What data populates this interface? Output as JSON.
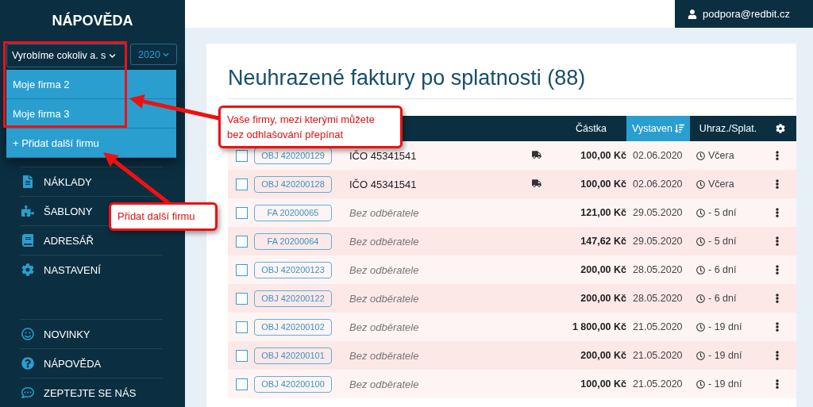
{
  "sidebar": {
    "title": "NÁPOVĚDA",
    "company_select": {
      "value": "Vyrobíme cokoliv a. s"
    },
    "year_select": {
      "value": "2020"
    },
    "company_menu": {
      "expanded": true,
      "items": [
        {
          "label": "Moje firma 2"
        },
        {
          "label": "Moje firma 3"
        }
      ],
      "add_label": "+ Přidat další firmu"
    },
    "nav": [
      {
        "label": "NÁKLADY"
      },
      {
        "label": "ŠABLONY"
      },
      {
        "label": "ADRESÁŘ"
      },
      {
        "label": "NASTAVENÍ"
      }
    ],
    "bottom_nav": [
      {
        "label": "NOVINKY"
      },
      {
        "label": "NÁPOVĚDA"
      },
      {
        "label": "ZEPTEJTE SE NÁS"
      }
    ]
  },
  "top_bar": {
    "user": "podpora@redbit.cz"
  },
  "page_title": "Neuhrazené faktury po splatnosti (88)",
  "table": {
    "columns": [
      {
        "label": "Částka",
        "selected": false
      },
      {
        "label": "Vystaven",
        "selected": true
      },
      {
        "label": "Uhraz./Splat.",
        "selected": false
      }
    ],
    "rows": [
      {
        "checked": false,
        "number": "OBJ 420200129",
        "customer": "IČO 45341541",
        "no_customer": false,
        "delivery": true,
        "amount": "100,00 Kč",
        "issued": "02.06.2020",
        "due": "Včera"
      },
      {
        "checked": false,
        "number": "OBJ 420200128",
        "customer": "IČO 45341541",
        "no_customer": false,
        "delivery": true,
        "amount": "100,00 Kč",
        "issued": "02.06.2020",
        "due": "Včera"
      },
      {
        "checked": false,
        "number": "FA 20200065",
        "customer": "Bez odběratele",
        "no_customer": true,
        "delivery": false,
        "amount": "121,00 Kč",
        "issued": "29.05.2020",
        "due": "- 5 dní"
      },
      {
        "checked": false,
        "number": "FA 20200064",
        "customer": "Bez odběratele",
        "no_customer": true,
        "delivery": false,
        "amount": "147,62 Kč",
        "issued": "29.05.2020",
        "due": "- 5 dní"
      },
      {
        "checked": false,
        "number": "OBJ 420200123",
        "customer": "Bez odběratele",
        "no_customer": true,
        "delivery": false,
        "amount": "200,00 Kč",
        "issued": "28.05.2020",
        "due": "- 6 dní"
      },
      {
        "checked": false,
        "number": "OBJ 420200122",
        "customer": "Bez odběratele",
        "no_customer": true,
        "delivery": false,
        "amount": "200,00 Kč",
        "issued": "28.05.2020",
        "due": "- 6 dní"
      },
      {
        "checked": false,
        "number": "OBJ 420200102",
        "customer": "Bez odběratele",
        "no_customer": true,
        "delivery": false,
        "amount": "1 800,00 Kč",
        "issued": "21.05.2020",
        "due": "- 19 dní"
      },
      {
        "checked": false,
        "number": "OBJ 420200101",
        "customer": "Bez odběratele",
        "no_customer": true,
        "delivery": false,
        "amount": "200,00 Kč",
        "issued": "21.05.2020",
        "due": "- 19 dní"
      },
      {
        "checked": false,
        "number": "OBJ 420200100",
        "customer": "Bez odběratele",
        "no_customer": true,
        "delivery": false,
        "amount": "100,00 Kč",
        "issued": "21.05.2020",
        "due": "- 19 dní"
      }
    ]
  },
  "annotations": [
    {
      "text": "Vaše firmy, mezi kterými můžete bez odhlašování přepínat"
    },
    {
      "text": "Přidat další firmu"
    }
  ]
}
